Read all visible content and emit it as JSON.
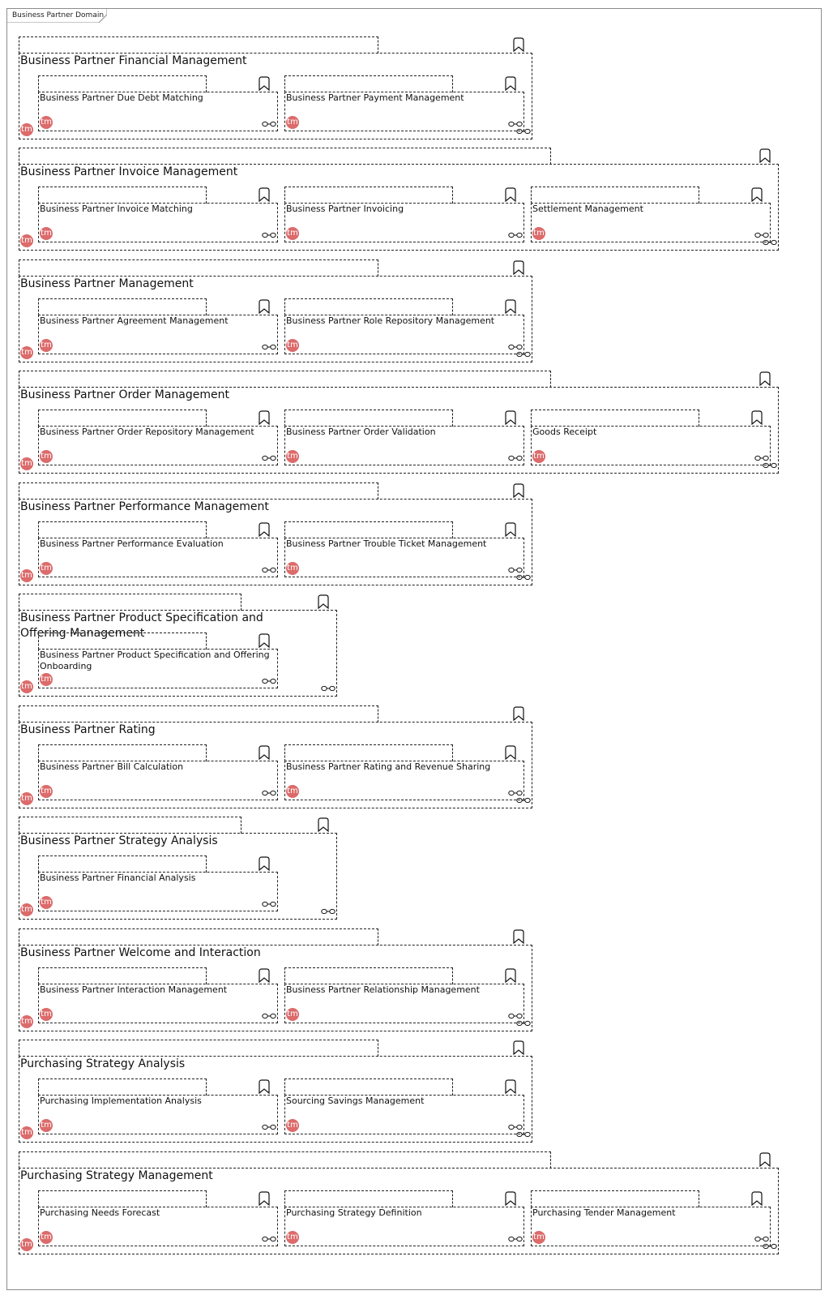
{
  "diagram_title": "Business Partner Domain",
  "badge_text": "tm",
  "colors": {
    "badge": "#dc6b6b",
    "line": "#222222",
    "frame": "#8c8c8c"
  },
  "icons": {
    "component": "bookmark-icon",
    "link": "chain-link-icon",
    "badge": "tm-badge-icon"
  },
  "groups": [
    {
      "title": "Business Partner Financial Management",
      "items": [
        {
          "title": "Business Partner Due Debt Matching"
        },
        {
          "title": "Business Partner Payment Management"
        }
      ]
    },
    {
      "title": "Business Partner Invoice Management",
      "items": [
        {
          "title": "Business Partner Invoice Matching"
        },
        {
          "title": "Business Partner Invoicing"
        },
        {
          "title": "Settlement Management"
        }
      ]
    },
    {
      "title": "Business Partner Management",
      "items": [
        {
          "title": "Business Partner Agreement Management"
        },
        {
          "title": "Business Partner Role Repository Management"
        }
      ]
    },
    {
      "title": "Business Partner Order Management",
      "items": [
        {
          "title": "Business Partner Order Repository Management"
        },
        {
          "title": "Business Partner Order Validation"
        },
        {
          "title": "Goods Receipt"
        }
      ]
    },
    {
      "title": "Business Partner Performance Management",
      "items": [
        {
          "title": "Business Partner Performance Evaluation"
        },
        {
          "title": "Business Partner Trouble Ticket Management"
        }
      ]
    },
    {
      "title": "Business Partner Product Specification and Offering Management",
      "items": [
        {
          "title": "Business Partner Product Specification and Offering Onboarding"
        }
      ]
    },
    {
      "title": "Business Partner Rating",
      "items": [
        {
          "title": "Business Partner Bill Calculation"
        },
        {
          "title": "Business Partner Rating and Revenue Sharing"
        }
      ]
    },
    {
      "title": "Business Partner Strategy Analysis",
      "items": [
        {
          "title": "Business Partner Financial Analysis"
        }
      ]
    },
    {
      "title": "Business Partner Welcome and Interaction",
      "items": [
        {
          "title": "Business Partner Interaction Management"
        },
        {
          "title": "Business Partner Relationship Management"
        }
      ]
    },
    {
      "title": "Purchasing Strategy Analysis",
      "items": [
        {
          "title": "Purchasing Implementation Analysis"
        },
        {
          "title": "Sourcing Savings Management"
        }
      ]
    },
    {
      "title": "Purchasing Strategy Management",
      "items": [
        {
          "title": "Purchasing Needs Forecast"
        },
        {
          "title": "Purchasing Strategy Definition"
        },
        {
          "title": "Purchasing Tender Management"
        }
      ]
    }
  ]
}
